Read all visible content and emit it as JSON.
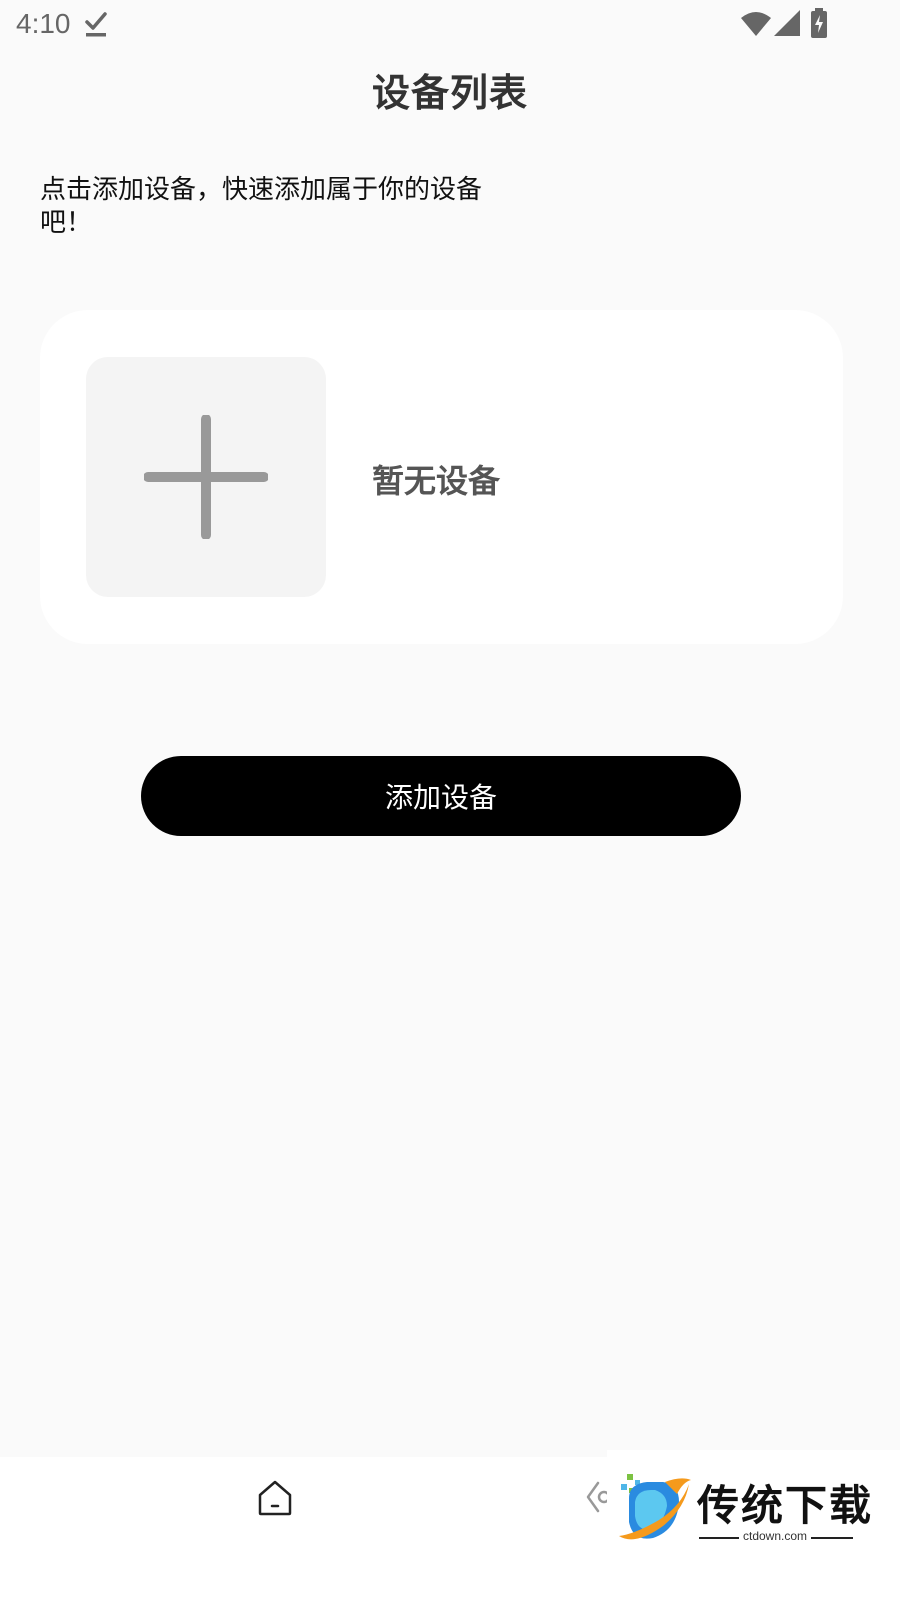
{
  "status_bar": {
    "time": "4:10"
  },
  "header": {
    "title": "设备列表"
  },
  "hint": {
    "text": "点击添加设备，快速添加属于你的设备吧！"
  },
  "device_card": {
    "empty_label": "暂无设备"
  },
  "actions": {
    "add_device_label": "添加设备"
  },
  "watermark": {
    "title": "传统下载",
    "subtitle": "ctdown.com"
  },
  "colors": {
    "background": "#fafafa",
    "card": "#ffffff",
    "tile": "#f4f4f4",
    "button": "#000000",
    "plus": "#999999"
  }
}
